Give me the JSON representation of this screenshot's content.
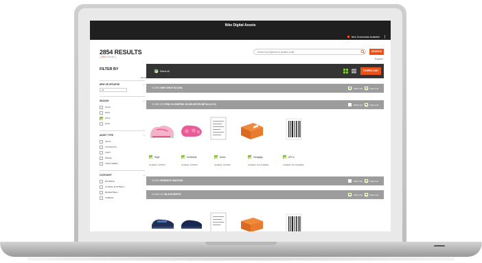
{
  "app": {
    "title": "Nike Digital Assets"
  },
  "topbar": {
    "downloads_label": "New Downloads Available"
  },
  "results": {
    "count_label": "2854 RESULTS",
    "sub_highlight": "2854",
    "sub_text": "Results"
  },
  "search": {
    "placeholder": "Search by keyword or product code",
    "button_label": "SEARCH",
    "expand_label": "Expand"
  },
  "sidebar": {
    "title": "FILTER BY",
    "reset_label": "Reset",
    "groups": [
      {
        "label": "NEW OR UPDATED",
        "date_value": "All"
      },
      {
        "label": "SEASON",
        "options": [
          {
            "label": "HO13",
            "checked": false
          },
          {
            "label": "SP14",
            "checked": false
          },
          {
            "label": "SU14",
            "checked": true
          },
          {
            "label": "FA14",
            "checked": false
          }
        ]
      },
      {
        "label": "ASSET TYPE",
        "options": [
          {
            "label": "UPCS",
            "checked": false
          },
          {
            "label": "LP/ONLOTS",
            "checked": false
          },
          {
            "label": "COPY",
            "checked": false
          },
          {
            "label": "IMAGE",
            "checked": false
          },
          {
            "label": "TECH SHEET",
            "checked": false
          }
        ]
      },
      {
        "label": "CATEGORY",
        "options": [
          {
            "label": "RUNNING",
            "checked": false
          },
          {
            "label": "GLOBAL FOOTBALL",
            "checked": false
          },
          {
            "label": "BASKETBALL",
            "checked": false
          },
          {
            "label": "JORDAN",
            "checked": false
          }
        ]
      }
    ]
  },
  "toolbar": {
    "select_all_label": "Select all",
    "download_label": "DOWNLOAD"
  },
  "group_bars": [
    {
      "code": "313480",
      "name": "NIKE SHOX NZ (GS)"
    },
    {
      "code": "313480 609",
      "name": "PINK GLOW/PINK GLOW-WHITE-METALLIC SL"
    },
    {
      "code": "313618",
      "name": "WOMAN'S SWOOSH"
    },
    {
      "code": "313618 010",
      "name": "BLACK/WHITE"
    }
  ],
  "group_controls": {
    "watch_label": "Watch list",
    "select_label": "Select all"
  },
  "assets": [
    {
      "type": "Right",
      "updated_label": "Updated:",
      "updated_value": "11/2013"
    },
    {
      "type": "Underside",
      "updated_label": "Updated:",
      "updated_value": "11/2013"
    },
    {
      "type": "Notes",
      "updated_label": "Updated:",
      "updated_value": "12/2014"
    },
    {
      "type": "Hangtags",
      "updated_label": "Updated:",
      "updated_value": "Not Available"
    },
    {
      "type": "UPCs",
      "updated_label": "Updated:",
      "updated_value": "Not Available"
    }
  ],
  "colors": {
    "accent": "#e8521c",
    "check": "#8bc34a",
    "topbar": "#1f1f1f",
    "toolbar": "#343434",
    "group_bar": "#9c9c9c"
  }
}
